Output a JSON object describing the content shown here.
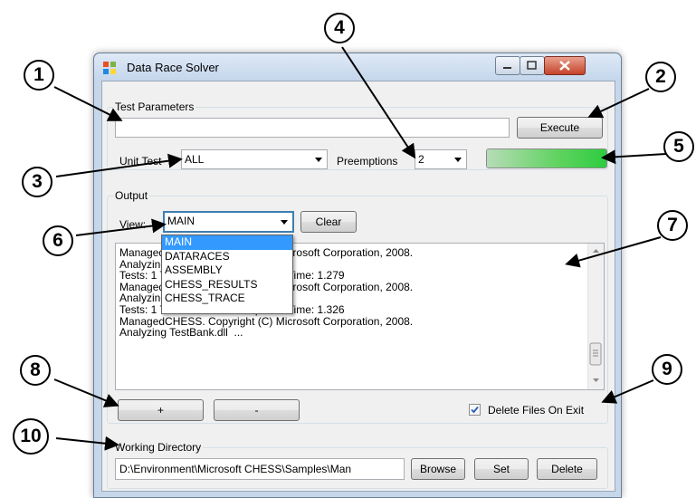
{
  "window": {
    "title": "Data Race Solver"
  },
  "test_parameters": {
    "group_label": "Test Parameters",
    "params_value": "",
    "execute_label": "Execute",
    "unit_test_label": "Unit Test",
    "unit_test_value": "ALL",
    "preemptions_label": "Preemptions",
    "preemptions_value": "2",
    "progress": 1.0
  },
  "output": {
    "group_label": "Output",
    "view_label": "View:",
    "view_value": "MAIN",
    "clear_label": "Clear",
    "view_options": [
      "MAIN",
      "DATARACES",
      "ASSEMBLY",
      "CHESS_RESULTS",
      "CHESS_TRACE"
    ],
    "lines": [
      "ManagedCHESS. Copyright (C) Microsoft Corporation, 2008.",
      "Analyzing TestBank.dll  ...",
      "Tests: 1 Threads: 3 ExecSteps: 14 Time: 1.279",
      "ManagedCHESS. Copyright (C) Microsoft Corporation, 2008.",
      "Analyzing TestBank.dll  ...",
      "Tests: 1 Threads: 3 ExecSteps: 14 Time: 1.326",
      "ManagedCHESS. Copyright (C) Microsoft Corporation, 2008.",
      "Analyzing TestBank.dll  ..."
    ],
    "plus_label": "+",
    "minus_label": "-",
    "delete_files_label": "Delete Files On Exit",
    "delete_files_checked": true
  },
  "working_directory": {
    "group_label": "Working Directory",
    "path": "D:\\Environment\\Microsoft CHESS\\Samples\\Man",
    "browse_label": "Browse",
    "set_label": "Set",
    "delete_label": "Delete"
  },
  "callouts": [
    "1",
    "2",
    "3",
    "4",
    "5",
    "6",
    "7",
    "8",
    "9",
    "10"
  ],
  "colors": {
    "progress_green": "#2ecc40",
    "selection": "#3399ff",
    "close_button": "#c5432a"
  }
}
